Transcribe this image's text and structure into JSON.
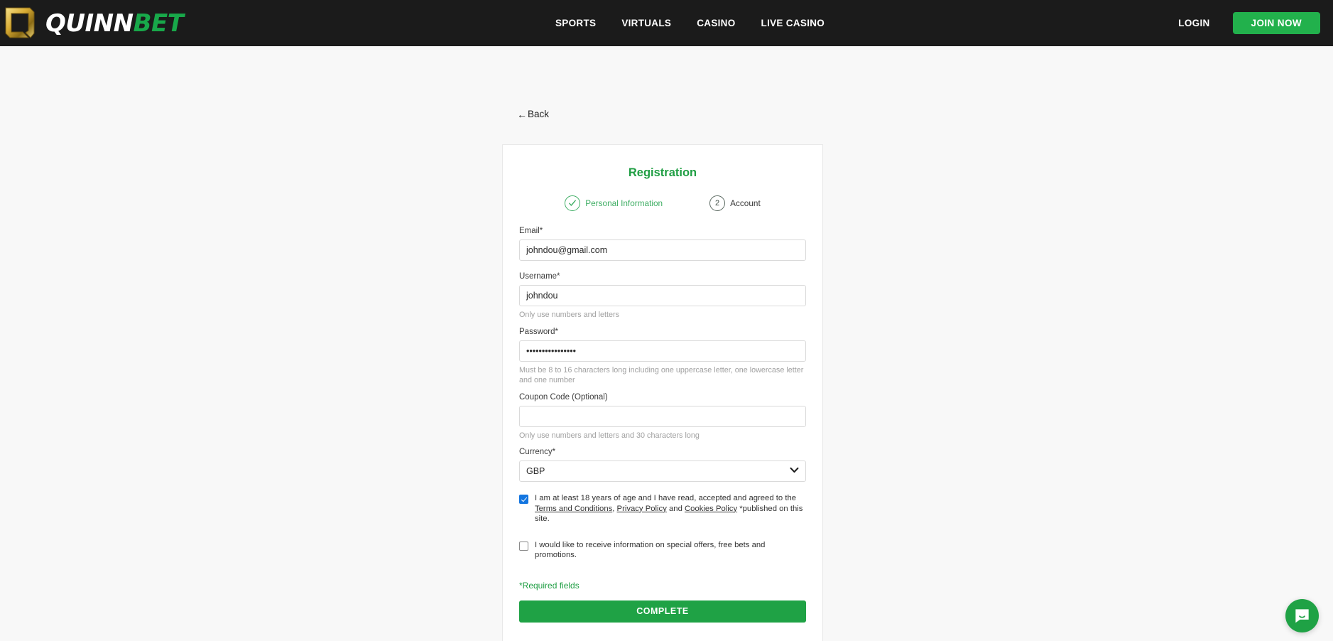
{
  "header": {
    "logo": {
      "mark": "Q",
      "name_part1": "QUINN",
      "name_part2": "BET"
    },
    "nav": [
      {
        "label": "SPORTS"
      },
      {
        "label": "VIRTUALS"
      },
      {
        "label": "CASINO"
      },
      {
        "label": "LIVE CASINO"
      }
    ],
    "login_label": "LOGIN",
    "join_label": "JOIN NOW"
  },
  "back": {
    "arrow": "←",
    "label": "Back"
  },
  "registration": {
    "title": "Registration",
    "steps": [
      {
        "marker": "✓",
        "label": "Personal Information",
        "state": "done"
      },
      {
        "marker": "2",
        "label": "Account",
        "state": "current"
      }
    ],
    "fields": {
      "email": {
        "label": "Email*",
        "value": "johndou@gmail.com",
        "placeholder": ""
      },
      "username": {
        "label": "Username*",
        "value": "johndou",
        "placeholder": "",
        "helper": "Only use numbers and letters"
      },
      "password": {
        "label": "Password*",
        "value": "••••••••••••••••",
        "placeholder": "",
        "helper": "Must be 8 to 16 characters long including one uppercase letter, one lowercase letter and one number"
      },
      "coupon": {
        "label": "Coupon Code (Optional)",
        "value": "",
        "placeholder": "",
        "helper": "Only use numbers and letters and 30 characters long"
      },
      "currency": {
        "label": "Currency*",
        "value": "GBP",
        "options": [
          "GBP"
        ]
      }
    },
    "consent": {
      "age_terms": {
        "checked": true,
        "text_before": "I am at least 18 years of age and I have read, accepted and agreed to the ",
        "link_terms": "Terms and Conditions",
        "text_mid1": ", ",
        "link_privacy": "Privacy Policy",
        "text_mid2": " and ",
        "link_cookies": "Cookies Policy",
        "text_after": " *published on this site."
      },
      "marketing": {
        "checked": false,
        "text": "I would like to receive information on special offers, free bets and promotions."
      }
    },
    "required_note": "*Required fields",
    "submit_label": "COMPLETE"
  },
  "chat": {
    "label": "chat-bubble-icon"
  },
  "colors": {
    "brand_green": "#1fa245",
    "header_bg": "#1b1b1b",
    "page_bg": "#f8f8f8",
    "checkbox_blue": "#1275e0",
    "logo_gold": "#d9b43c"
  }
}
